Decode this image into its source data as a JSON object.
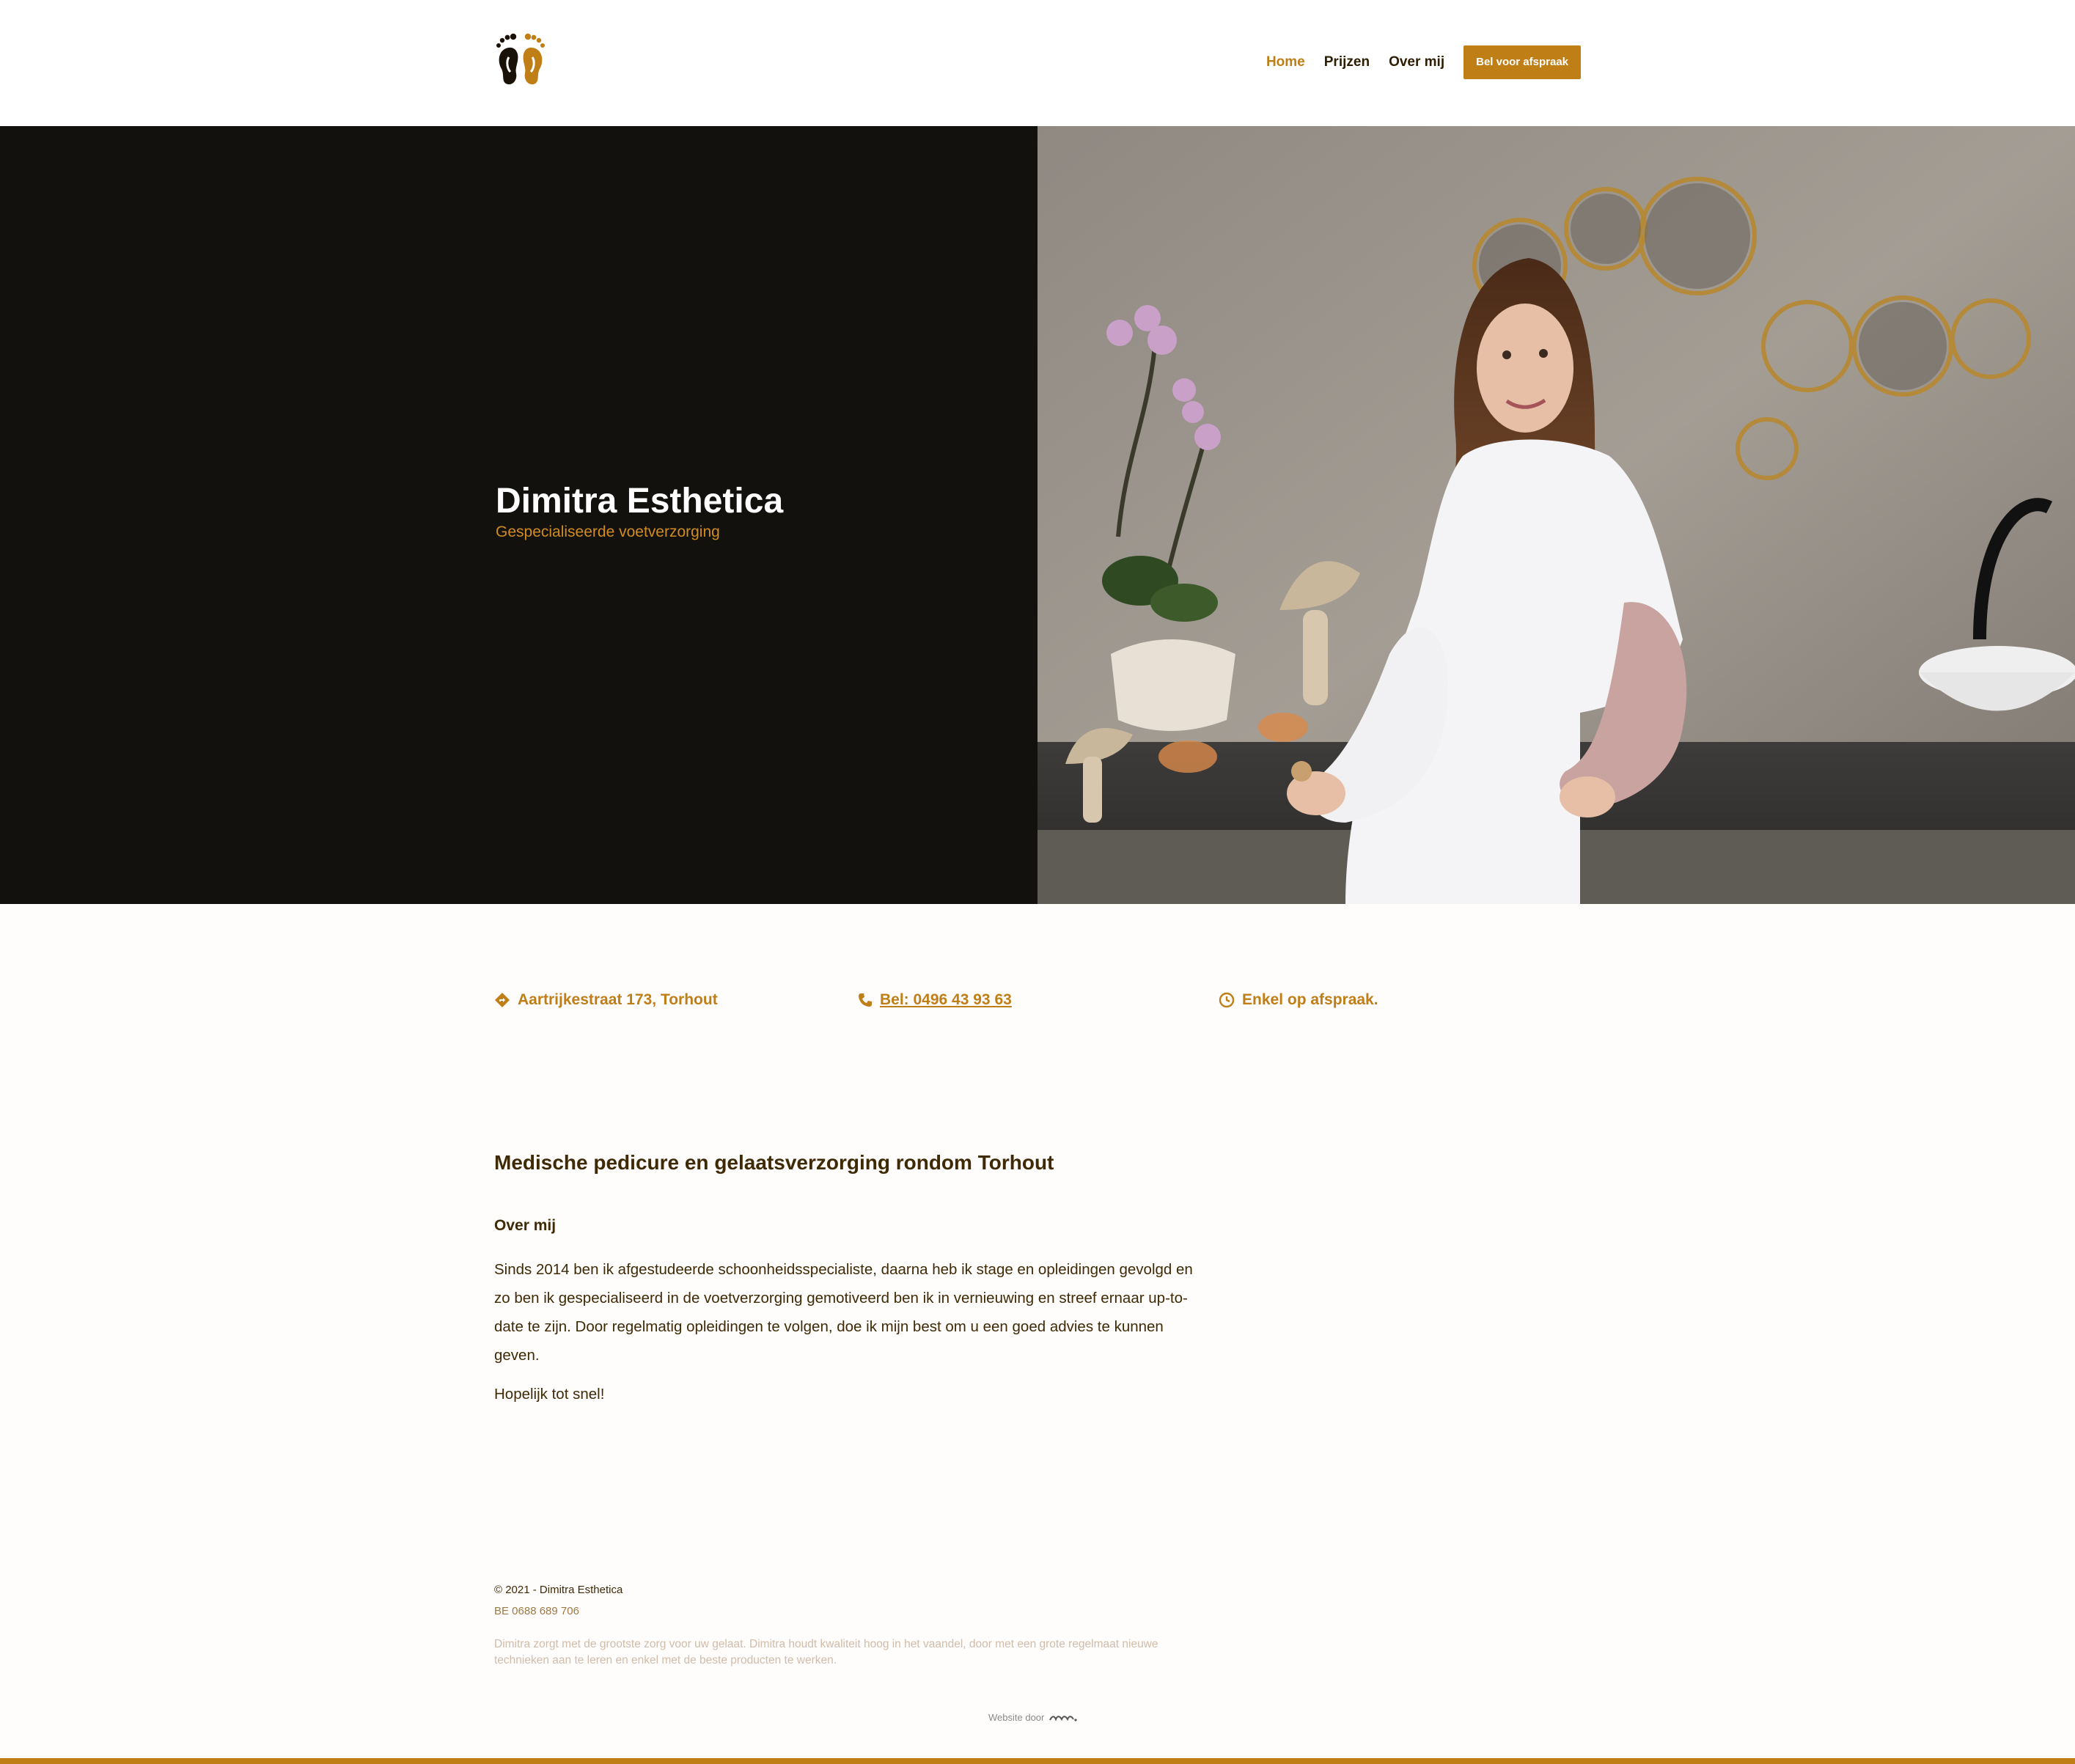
{
  "nav": {
    "items": [
      {
        "label": "Home",
        "active": true
      },
      {
        "label": "Prijzen",
        "active": false
      },
      {
        "label": "Over mij",
        "active": false
      }
    ],
    "cta_label": "Bel voor afspraak"
  },
  "hero": {
    "title": "Dimitra Esthetica",
    "subtitle": "Gespecialiseerde voetverzorging",
    "image_alt": "photo-woman-in-salon"
  },
  "info": {
    "address": "Aartrijkestraat 173, Torhout",
    "phone": "Bel: 0496 43 93 63",
    "hours": "Enkel op afspraak."
  },
  "content": {
    "heading": "Medische pedicure en gelaatsverzorging rondom Torhout",
    "subheading": "Over mij",
    "paragraph": "Sinds 2014 ben ik afgestudeerde schoonheidsspecialiste, daarna heb ik stage en opleidingen gevolgd en zo ben ik gespecialiseerd in de voetverzorging gemotiveerd ben ik in vernieuwing en streef ernaar up-to-date te zijn. Door regelmatig opleidingen te volgen, doe ik mijn best om u een goed advies te kunnen geven.",
    "closing": "Hopelijk tot snel!"
  },
  "footer": {
    "copyright": "© 2021 - Dimitra Esthetica",
    "vat": "BE 0688 689 706",
    "description": "Dimitra zorgt met de grootste zorg voor uw gelaat. Dimitra houdt kwaliteit hoog in het vaandel, door met een grote regelmaat nieuwe technieken aan te leren en enkel met de beste producten te werken.",
    "credit": "Website door"
  },
  "colors": {
    "accent": "#c07e16",
    "text": "#3f2a06",
    "hero_dark": "#13110e"
  }
}
